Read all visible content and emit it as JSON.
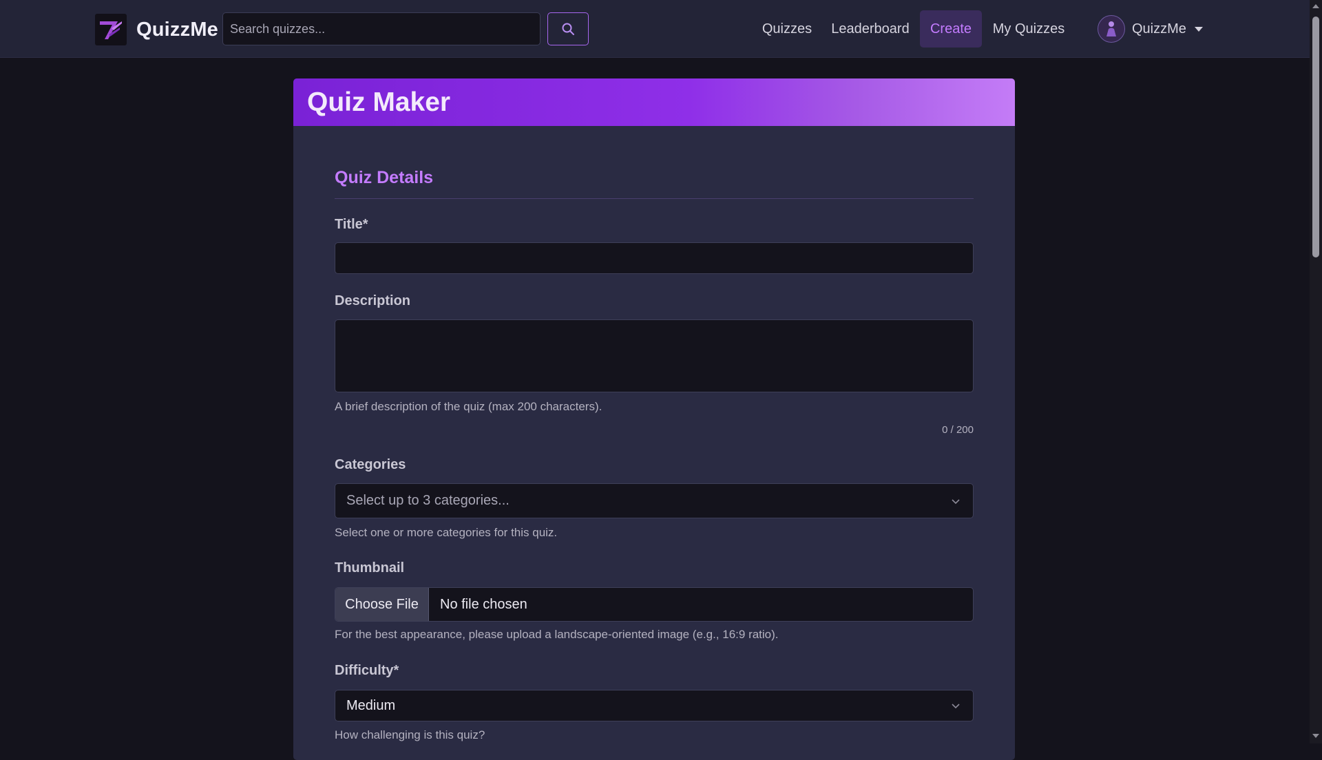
{
  "navbar": {
    "brand": "QuizzMe",
    "search_placeholder": "Search quizzes...",
    "links": [
      "Quizzes",
      "Leaderboard",
      "Create",
      "My Quizzes"
    ],
    "active_link": "Create",
    "user_name": "QuizzMe"
  },
  "card": {
    "title": "Quiz Maker",
    "section_title": "Quiz Details",
    "title_label": "Title*",
    "title_value": "",
    "description_label": "Description",
    "description_value": "",
    "description_hint": "A brief description of the quiz (max 200 characters).",
    "description_counter": "0 / 200",
    "categories_label": "Categories",
    "categories_placeholder": "Select up to 3 categories...",
    "categories_hint": "Select one or more categories for this quiz.",
    "thumbnail_label": "Thumbnail",
    "thumbnail_button": "Choose File",
    "thumbnail_status": "No file chosen",
    "thumbnail_hint": "For the best appearance, please upload a landscape-oriented image (e.g., 16:9 ratio).",
    "difficulty_label": "Difficulty*",
    "difficulty_value": "Medium",
    "difficulty_hint": "How challenging is this quiz?"
  },
  "colors": {
    "accent": "#c47cff",
    "header_gradient_start": "#7a22d6",
    "header_gradient_end": "#c47cf7",
    "background": "#14131c",
    "card": "#2a2b43",
    "navbar": "#232437"
  },
  "icons": {
    "logo": "quizzme-logo-icon",
    "search": "search-icon",
    "avatar": "user-avatar-icon",
    "caret": "caret-down-icon",
    "chevron": "chevron-down-icon"
  }
}
